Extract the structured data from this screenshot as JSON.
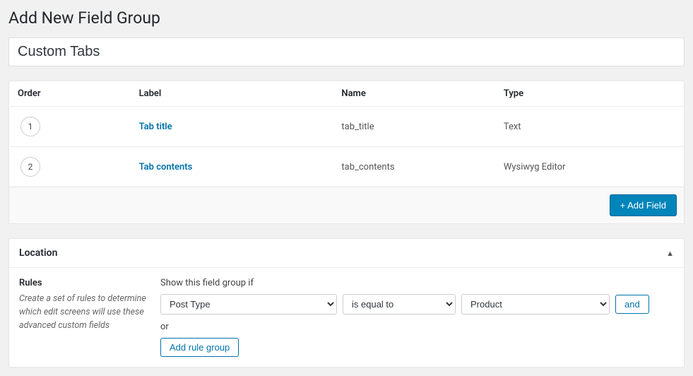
{
  "page_title": "Add New Field Group",
  "group_title_value": "Custom Tabs",
  "fields_table": {
    "headers": {
      "order": "Order",
      "label": "Label",
      "name": "Name",
      "type": "Type"
    },
    "rows": [
      {
        "order": "1",
        "label": "Tab title",
        "name": "tab_title",
        "type": "Text"
      },
      {
        "order": "2",
        "label": "Tab contents",
        "name": "tab_contents",
        "type": "Wysiwyg Editor"
      }
    ]
  },
  "add_field_button": "+ Add Field",
  "location_panel": {
    "title": "Location",
    "rules_heading": "Rules",
    "rules_description": "Create a set of rules to determine which edit screens will use these advanced custom fields",
    "show_if_label": "Show this field group if",
    "rule": {
      "param": "Post Type",
      "operator": "is equal to",
      "value": "Product"
    },
    "and_button": "and",
    "or_label": "or",
    "add_rule_group_button": "Add rule group"
  }
}
